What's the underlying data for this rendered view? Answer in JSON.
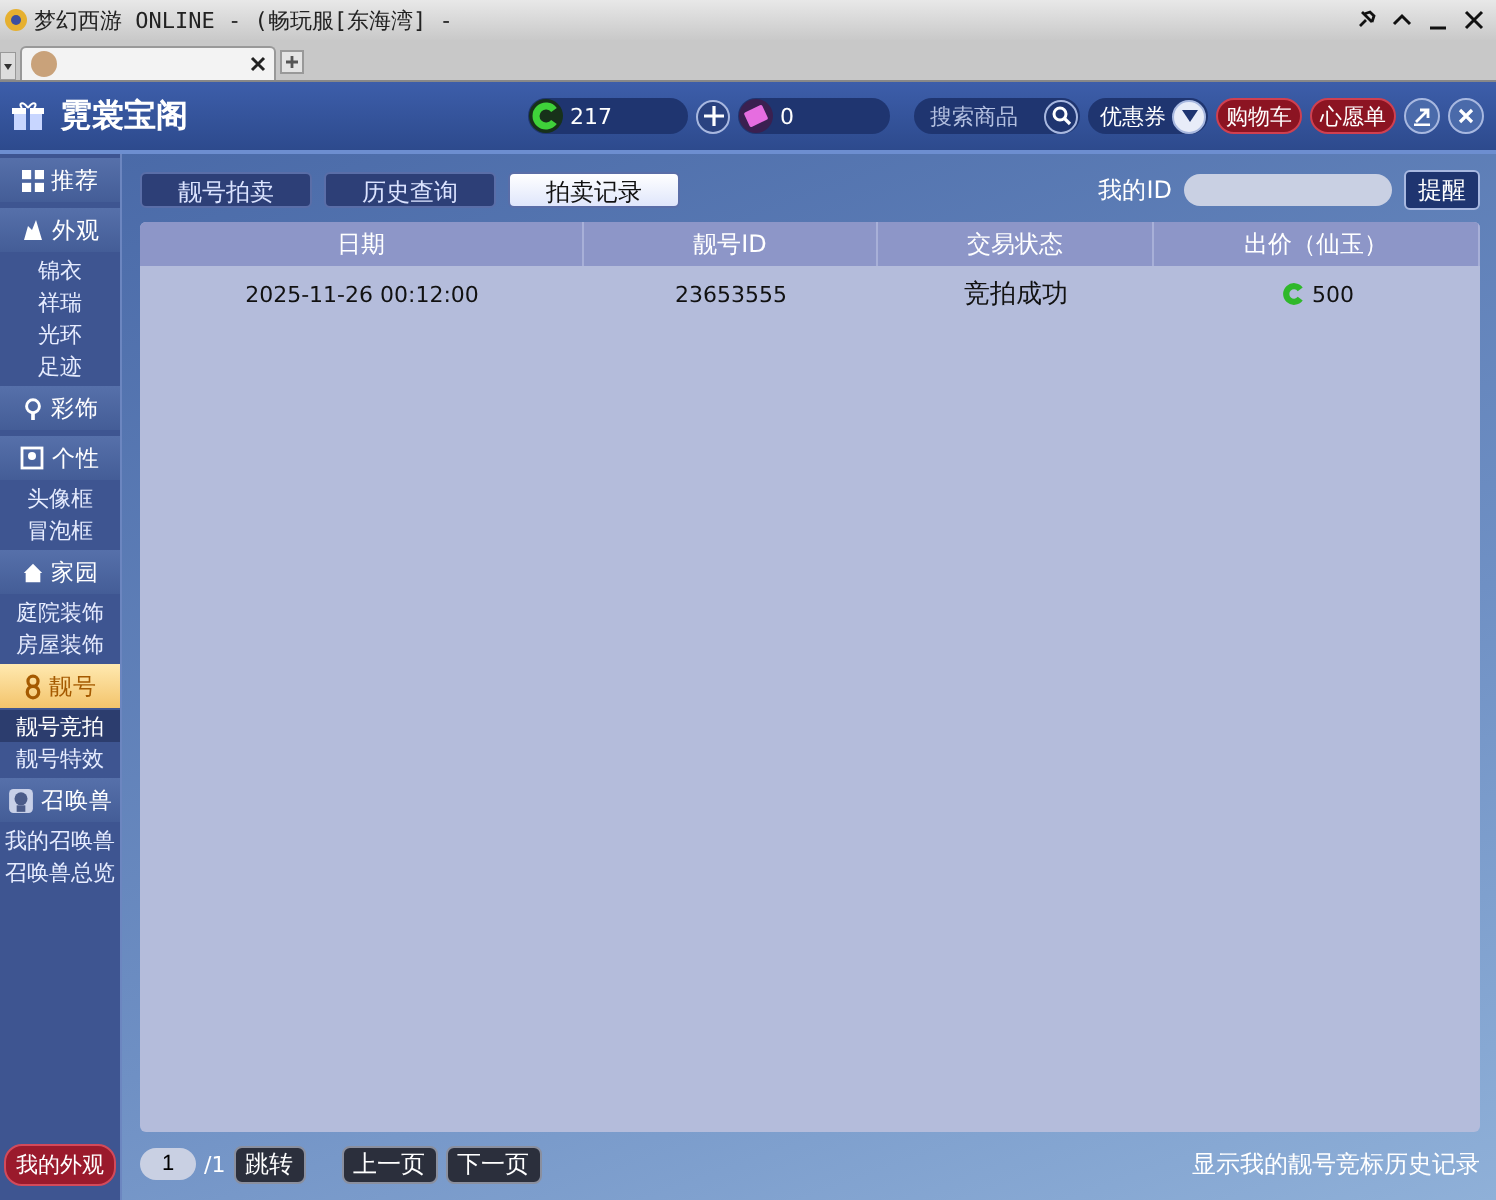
{
  "window": {
    "title": "梦幻西游 ONLINE - (畅玩服[东海湾] -"
  },
  "header": {
    "title": "霓裳宝阁",
    "currency": "217",
    "tickets": "0",
    "search": {
      "placeholder": "搜索商品"
    },
    "coupon": "优惠券",
    "buttons": [
      "购物车",
      "心愿单"
    ]
  },
  "sidebar": {
    "items": [
      {
        "kind": "category",
        "label": "推荐",
        "selected": false
      },
      {
        "kind": "category",
        "label": "外观",
        "selected": false
      },
      {
        "kind": "sub",
        "label": "锦衣",
        "selected": false
      },
      {
        "kind": "sub",
        "label": "祥瑞",
        "selected": false
      },
      {
        "kind": "sub",
        "label": "光环",
        "selected": false
      },
      {
        "kind": "sub",
        "label": "足迹",
        "selected": false
      },
      {
        "kind": "category",
        "label": "彩饰",
        "selected": false
      },
      {
        "kind": "category",
        "label": "个性",
        "selected": false
      },
      {
        "kind": "sub",
        "label": "头像框",
        "selected": false
      },
      {
        "kind": "sub",
        "label": "冒泡框",
        "selected": false
      },
      {
        "kind": "category",
        "label": "家园",
        "selected": false
      },
      {
        "kind": "sub",
        "label": "庭院装饰",
        "selected": false
      },
      {
        "kind": "sub",
        "label": "房屋装饰",
        "selected": false
      },
      {
        "kind": "category",
        "label": "靓号",
        "selected": true
      },
      {
        "kind": "sub",
        "label": "靓号竞拍",
        "selected": true
      },
      {
        "kind": "sub",
        "label": "靓号特效",
        "selected": false
      },
      {
        "kind": "category",
        "label": "召唤兽",
        "selected": false
      },
      {
        "kind": "sub",
        "label": "我的召唤兽",
        "selected": false
      },
      {
        "kind": "sub",
        "label": "召唤兽总览",
        "selected": false
      }
    ],
    "footer_button": "我的外观"
  },
  "tabs": [
    {
      "label": "靓号拍卖",
      "selected": false
    },
    {
      "label": "历史查询",
      "selected": false
    },
    {
      "label": "拍卖记录",
      "selected": true
    }
  ],
  "my_id_label": "我的ID",
  "remind_button": "提醒",
  "table": {
    "columns": [
      "日期",
      "靓号ID",
      "交易状态",
      "出价（仙玉）"
    ],
    "rows": [
      {
        "date": "2025-11-26 00:12:00",
        "id": "23653555",
        "status": "竞拍成功",
        "price": "500"
      }
    ]
  },
  "pager": {
    "page": "1",
    "total": "/1",
    "jump": "跳转",
    "prev": "上一页",
    "next": "下一页"
  },
  "footer_note": "显示我的靓号竞标历史记录"
}
